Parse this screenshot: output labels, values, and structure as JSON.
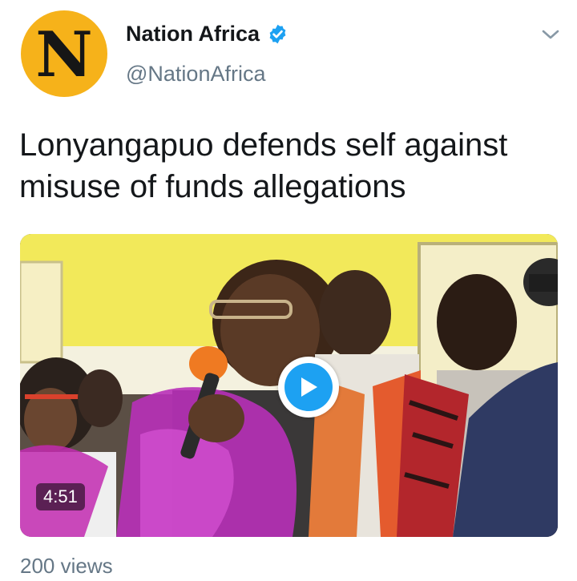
{
  "account": {
    "avatar_letter": "N",
    "display_name": "Nation Africa",
    "handle": "@NationAfrica",
    "verified_icon": "verified-badge-icon"
  },
  "menu_icon": "chevron-down-icon",
  "tweet": {
    "text": "Lonyangapuo defends self against misuse of funds allegations"
  },
  "video": {
    "duration": "4:51",
    "play_icon": "play-icon"
  },
  "footer": {
    "views": "200 views"
  },
  "colors": {
    "avatar_bg": "#f6b21a",
    "verified_blue": "#1da1f2",
    "muted_text": "#657786",
    "play_blue": "#1da1f2"
  }
}
